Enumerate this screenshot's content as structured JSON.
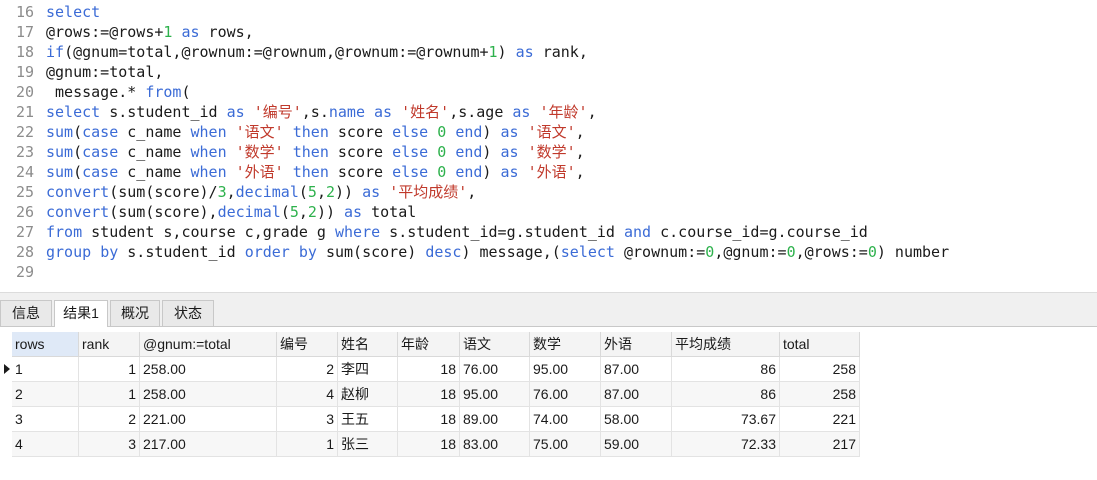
{
  "editor": {
    "lines": [
      {
        "n": "16",
        "tokens": [
          [
            "kw",
            "select"
          ]
        ]
      },
      {
        "n": "17",
        "tokens": [
          [
            "",
            "@rows:=@rows+"
          ],
          [
            "num",
            "1"
          ],
          [
            "",
            " "
          ],
          [
            "kw",
            "as"
          ],
          [
            "",
            " rows,"
          ]
        ]
      },
      {
        "n": "18",
        "tokens": [
          [
            "fn",
            "if"
          ],
          [
            "",
            "(@gnum=total,@rownum:=@rownum,@rownum:=@rownum+"
          ],
          [
            "num",
            "1"
          ],
          [
            "",
            ") "
          ],
          [
            "kw",
            "as"
          ],
          [
            "",
            " rank,"
          ]
        ]
      },
      {
        "n": "19",
        "tokens": [
          [
            "",
            "@gnum:=total,"
          ]
        ]
      },
      {
        "n": "20",
        "tokens": [
          [
            "",
            " message.* "
          ],
          [
            "kw",
            "from"
          ],
          [
            "",
            "("
          ]
        ]
      },
      {
        "n": "21",
        "tokens": [
          [
            "kw",
            "select"
          ],
          [
            "",
            " s.student_id "
          ],
          [
            "kw",
            "as"
          ],
          [
            "",
            " "
          ],
          [
            "str",
            "'编号'"
          ],
          [
            "",
            ",s."
          ],
          [
            "kw",
            "name"
          ],
          [
            "",
            " "
          ],
          [
            "kw",
            "as"
          ],
          [
            "",
            " "
          ],
          [
            "str",
            "'姓名'"
          ],
          [
            "",
            ",s.age "
          ],
          [
            "kw",
            "as"
          ],
          [
            "",
            " "
          ],
          [
            "str",
            "'年龄'"
          ],
          [
            "",
            ","
          ]
        ]
      },
      {
        "n": "22",
        "tokens": [
          [
            "fn",
            "sum"
          ],
          [
            "",
            "("
          ],
          [
            "kw",
            "case"
          ],
          [
            "",
            " c_name "
          ],
          [
            "kw",
            "when"
          ],
          [
            "",
            " "
          ],
          [
            "str",
            "'语文'"
          ],
          [
            "",
            " "
          ],
          [
            "kw",
            "then"
          ],
          [
            "",
            " score "
          ],
          [
            "kw",
            "else"
          ],
          [
            "",
            " "
          ],
          [
            "num",
            "0"
          ],
          [
            "",
            " "
          ],
          [
            "kw",
            "end"
          ],
          [
            "",
            ") "
          ],
          [
            "kw",
            "as"
          ],
          [
            "",
            " "
          ],
          [
            "str",
            "'语文'"
          ],
          [
            "",
            ","
          ]
        ]
      },
      {
        "n": "23",
        "tokens": [
          [
            "fn",
            "sum"
          ],
          [
            "",
            "("
          ],
          [
            "kw",
            "case"
          ],
          [
            "",
            " c_name "
          ],
          [
            "kw",
            "when"
          ],
          [
            "",
            " "
          ],
          [
            "str",
            "'数学'"
          ],
          [
            "",
            " "
          ],
          [
            "kw",
            "then"
          ],
          [
            "",
            " score "
          ],
          [
            "kw",
            "else"
          ],
          [
            "",
            " "
          ],
          [
            "num",
            "0"
          ],
          [
            "",
            " "
          ],
          [
            "kw",
            "end"
          ],
          [
            "",
            ") "
          ],
          [
            "kw",
            "as"
          ],
          [
            "",
            " "
          ],
          [
            "str",
            "'数学'"
          ],
          [
            "",
            ","
          ]
        ]
      },
      {
        "n": "24",
        "tokens": [
          [
            "fn",
            "sum"
          ],
          [
            "",
            "("
          ],
          [
            "kw",
            "case"
          ],
          [
            "",
            " c_name "
          ],
          [
            "kw",
            "when"
          ],
          [
            "",
            " "
          ],
          [
            "str",
            "'外语'"
          ],
          [
            "",
            " "
          ],
          [
            "kw",
            "then"
          ],
          [
            "",
            " score "
          ],
          [
            "kw",
            "else"
          ],
          [
            "",
            " "
          ],
          [
            "num",
            "0"
          ],
          [
            "",
            " "
          ],
          [
            "kw",
            "end"
          ],
          [
            "",
            ") "
          ],
          [
            "kw",
            "as"
          ],
          [
            "",
            " "
          ],
          [
            "str",
            "'外语'"
          ],
          [
            "",
            ","
          ]
        ]
      },
      {
        "n": "25",
        "tokens": [
          [
            "fn",
            "convert"
          ],
          [
            "",
            "(sum(score)/"
          ],
          [
            "num",
            "3"
          ],
          [
            "",
            ","
          ],
          [
            "fn",
            "decimal"
          ],
          [
            "",
            "("
          ],
          [
            "num",
            "5"
          ],
          [
            "",
            ","
          ],
          [
            "num",
            "2"
          ],
          [
            "",
            "))"
          ],
          [
            "",
            " "
          ],
          [
            "kw",
            "as"
          ],
          [
            "",
            " "
          ],
          [
            "str",
            "'平均成绩'"
          ],
          [
            "",
            ","
          ]
        ]
      },
      {
        "n": "26",
        "tokens": [
          [
            "fn",
            "convert"
          ],
          [
            "",
            "(sum(score),"
          ],
          [
            "fn",
            "decimal"
          ],
          [
            "",
            "("
          ],
          [
            "num",
            "5"
          ],
          [
            "",
            ","
          ],
          [
            "num",
            "2"
          ],
          [
            "",
            "))"
          ],
          [
            "",
            " "
          ],
          [
            "kw",
            "as"
          ],
          [
            "",
            " total"
          ]
        ]
      },
      {
        "n": "27",
        "tokens": [
          [
            "kw",
            "from"
          ],
          [
            "",
            " student s,course c,grade g "
          ],
          [
            "kw",
            "where"
          ],
          [
            "",
            " s.student_id=g.student_id "
          ],
          [
            "kw",
            "and"
          ],
          [
            "",
            " c.course_id=g.course_id"
          ]
        ]
      },
      {
        "n": "28",
        "tokens": [
          [
            "kw",
            "group"
          ],
          [
            "",
            " "
          ],
          [
            "kw",
            "by"
          ],
          [
            "",
            " s.student_id "
          ],
          [
            "kw",
            "order"
          ],
          [
            "",
            " "
          ],
          [
            "kw",
            "by"
          ],
          [
            "",
            " sum(score) "
          ],
          [
            "kw",
            "desc"
          ],
          [
            "",
            ") message,("
          ],
          [
            "kw",
            "select"
          ],
          [
            "",
            " @rownum:="
          ],
          [
            "num",
            "0"
          ],
          [
            "",
            ",@gnum:="
          ],
          [
            "num",
            "0"
          ],
          [
            "",
            ",@rows:="
          ],
          [
            "num",
            "0"
          ],
          [
            "",
            ") number"
          ]
        ]
      },
      {
        "n": "29",
        "tokens": []
      }
    ]
  },
  "tabs": [
    {
      "label": "信息",
      "active": false
    },
    {
      "label": "结果1",
      "active": true
    },
    {
      "label": "概况",
      "active": false
    },
    {
      "label": "状态",
      "active": false
    }
  ],
  "grid": {
    "columns": [
      "rows",
      "rank",
      "@gnum:=total",
      "编号",
      "姓名",
      "年龄",
      "语文",
      "数学",
      "外语",
      "平均成绩",
      "total"
    ],
    "rows": [
      [
        "1",
        "1",
        "258.00",
        "2",
        "李四",
        "18",
        "76.00",
        "95.00",
        "87.00",
        "86",
        "258"
      ],
      [
        "2",
        "1",
        "258.00",
        "4",
        "赵柳",
        "18",
        "95.00",
        "76.00",
        "87.00",
        "86",
        "258"
      ],
      [
        "3",
        "2",
        "221.00",
        "3",
        "王五",
        "18",
        "89.00",
        "74.00",
        "58.00",
        "73.67",
        "221"
      ],
      [
        "4",
        "3",
        "217.00",
        "1",
        "张三",
        "18",
        "83.00",
        "75.00",
        "59.00",
        "72.33",
        "217"
      ]
    ],
    "current_row": 0
  }
}
